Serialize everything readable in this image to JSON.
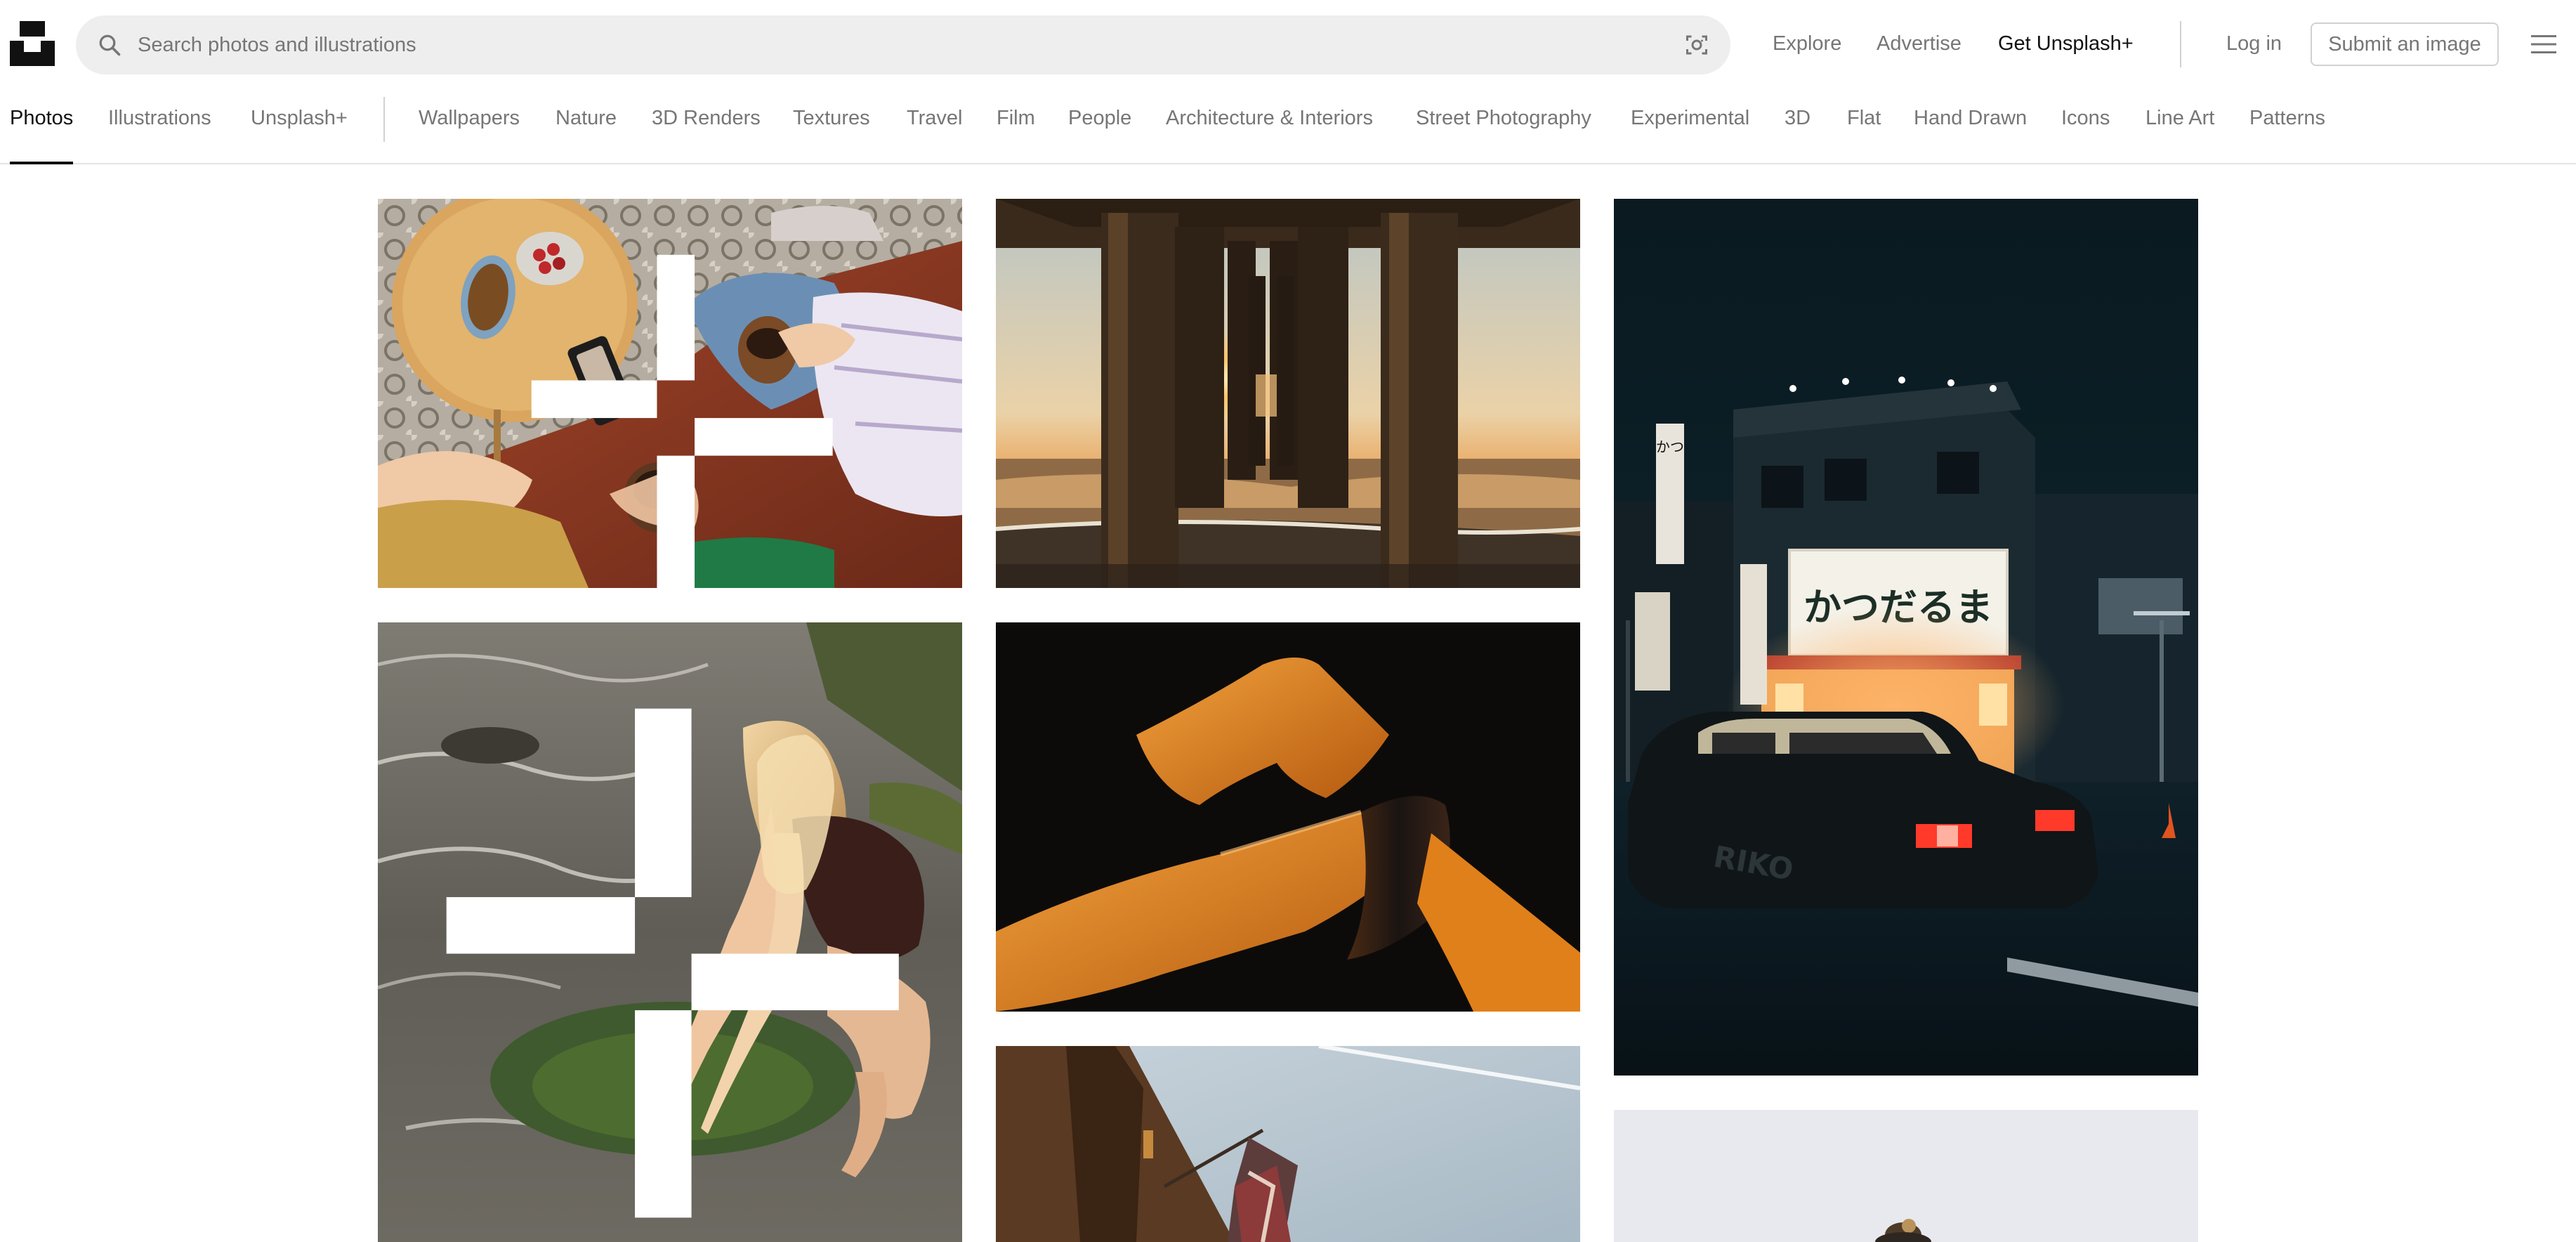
{
  "header": {
    "logo_icon": "unsplash-logo-icon",
    "search": {
      "placeholder": "Search photos and illustrations",
      "value": "",
      "icon": "search-icon",
      "visual_search_icon": "visual-search-icon"
    },
    "links": {
      "explore": "Explore",
      "advertise": "Advertise",
      "get_plus": "Get Unsplash+",
      "login": "Log in"
    },
    "submit_label": "Submit an image",
    "menu_icon": "hamburger-menu-icon"
  },
  "nav": {
    "primary": [
      {
        "label": "Photos",
        "active": true
      },
      {
        "label": "Illustrations",
        "active": false
      },
      {
        "label": "Unsplash+",
        "active": false
      }
    ],
    "topics": [
      "Wallpapers",
      "Nature",
      "3D Renders",
      "Textures",
      "Travel",
      "Film",
      "People",
      "Architecture & Interiors",
      "Street Photography",
      "Experimental",
      "3D",
      "Flat",
      "Hand Drawn",
      "Icons",
      "Line Art",
      "Patterns"
    ]
  },
  "photos": [
    {
      "subject": "coffee-lounge",
      "plus": true
    },
    {
      "subject": "pier-sunset",
      "plus": false
    },
    {
      "subject": "tokyo-street-night",
      "plus": false
    },
    {
      "subject": "woman-river",
      "plus": true
    },
    {
      "subject": "orange-ribbon-3d",
      "plus": false
    },
    {
      "subject": "building-flags",
      "plus": false
    },
    {
      "subject": "bird-sky",
      "plus": false
    }
  ],
  "photo_text": {
    "store_sign": "かつだるま",
    "store_vertical_sign": "かつ",
    "taxi_text": "RIKO"
  },
  "colors": {
    "text_primary": "#111111",
    "text_secondary": "#767676",
    "search_bg": "#eeeeee",
    "border": "#d1d1d1"
  }
}
